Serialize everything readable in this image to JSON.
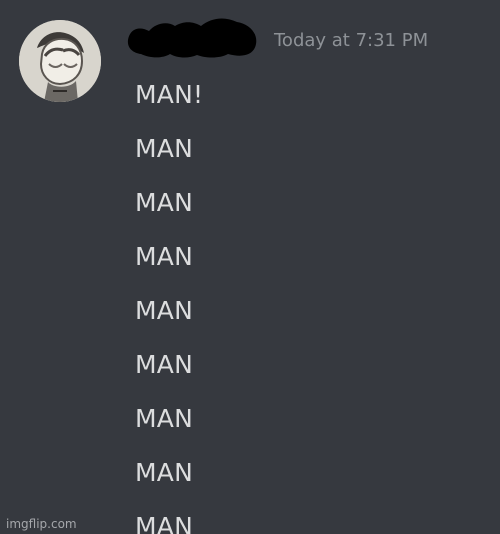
{
  "message": {
    "timestamp": "Today at 7:31 PM",
    "lines": [
      "MAN!",
      "MAN",
      "MAN",
      "MAN",
      "MAN",
      "MAN",
      "MAN",
      "MAN",
      "MAN"
    ]
  },
  "icons": {
    "avatar": "avatar-image",
    "username": "redacted-username"
  },
  "colors": {
    "background": "#36393f",
    "text": "#dcddde",
    "timestamp": "#8e9297"
  },
  "watermark": "imgflip.com"
}
